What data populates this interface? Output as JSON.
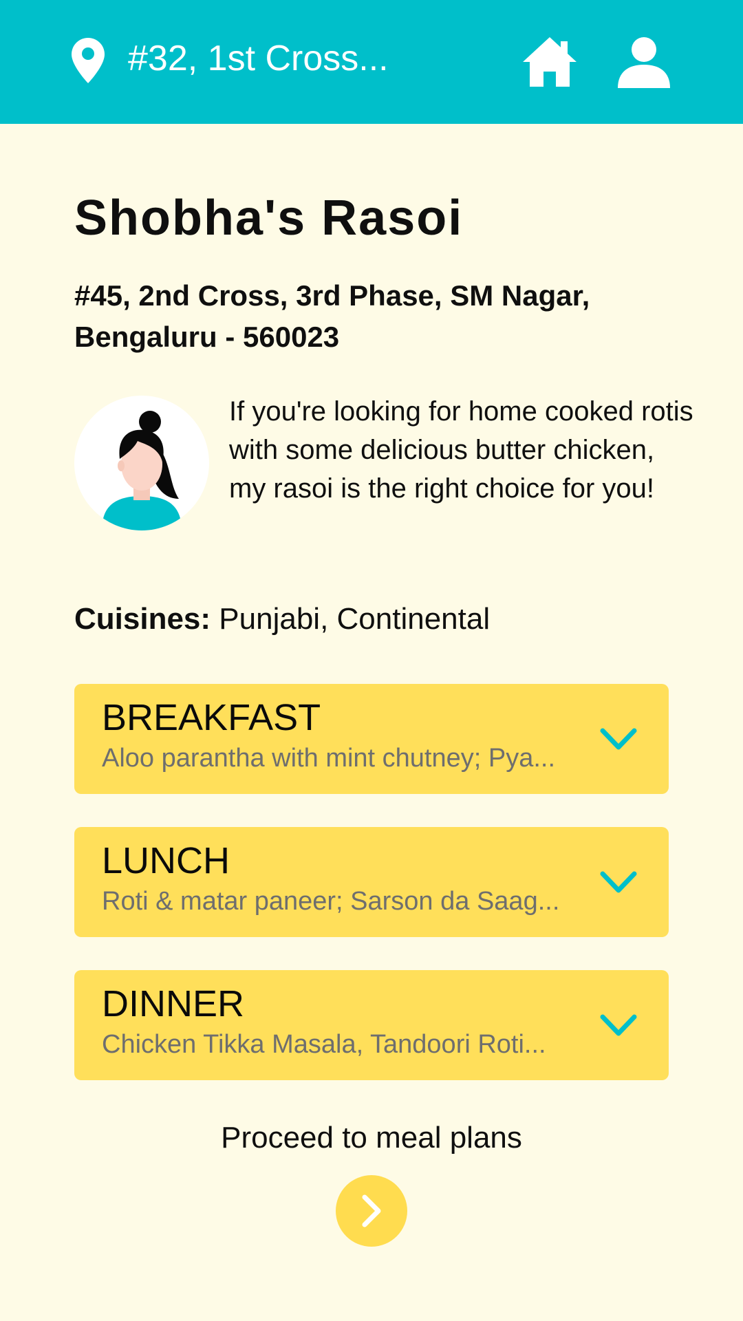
{
  "header": {
    "address_short": "#32, 1st Cross...",
    "background_color": "#00bfca",
    "icons": [
      "location-pin-icon",
      "home-icon",
      "user-icon"
    ]
  },
  "kitchen": {
    "name": "Shobha's Rasoi",
    "address": "#45, 2nd Cross, 3rd Phase, SM Nagar, Bengaluru - 560023",
    "bio": "If you're looking for home cooked rotis with some delicious butter chicken, my rasoi is the right choice for you!",
    "cuisines_label": "Cuisines:",
    "cuisines": "Punjabi, Continental"
  },
  "meals": [
    {
      "title": "BREAKFAST",
      "description": "Aloo parantha with mint chutney; Pya..."
    },
    {
      "title": "LUNCH",
      "description": "Roti & matar paneer; Sarson da Saag..."
    },
    {
      "title": "DINNER",
      "description": "Chicken Tikka Masala, Tandoori Roti..."
    }
  ],
  "proceed_label": "Proceed to meal plans",
  "colors": {
    "accent": "#00bfca",
    "card": "#ffdf5a",
    "background": "#fefbe6"
  }
}
